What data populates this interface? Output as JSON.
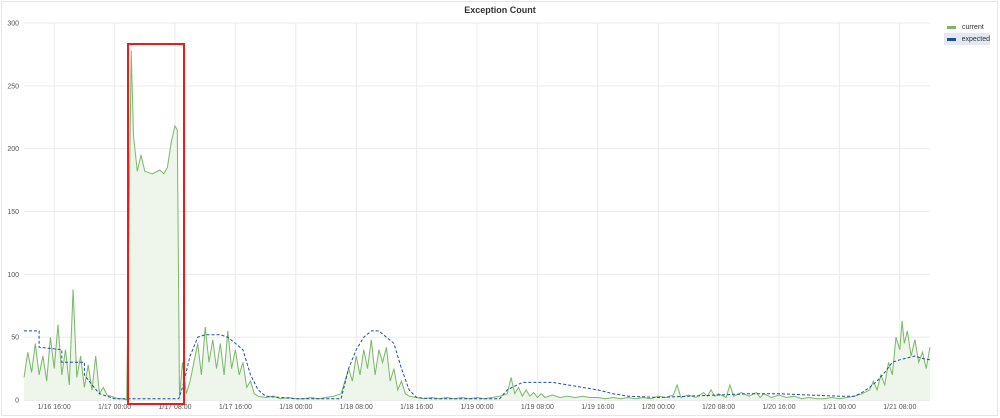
{
  "panel": {
    "title": "Exception Count"
  },
  "legend": {
    "items": [
      {
        "label": "current",
        "color": "#7ab76a"
      },
      {
        "label": "expected",
        "color": "#1f4e9c"
      }
    ]
  },
  "chart_data": {
    "type": "line",
    "title": "Exception Count",
    "xlabel": "",
    "ylabel": "",
    "ylim": [
      0,
      300
    ],
    "yticks": [
      0,
      50,
      100,
      150,
      200,
      250,
      300
    ],
    "x_unit": "hours since 1/16 12:00 (tick labels shown as dates)",
    "xlim": [
      0,
      120
    ],
    "xticks": [
      {
        "x": 4,
        "label": "1/16 16:00"
      },
      {
        "x": 12,
        "label": "1/17 00:00"
      },
      {
        "x": 20,
        "label": "1/17 08:00"
      },
      {
        "x": 28,
        "label": "1/17 16:00"
      },
      {
        "x": 36,
        "label": "1/18 00:00"
      },
      {
        "x": 44,
        "label": "1/18 08:00"
      },
      {
        "x": 52,
        "label": "1/18 16:00"
      },
      {
        "x": 60,
        "label": "1/19 00:00"
      },
      {
        "x": 68,
        "label": "1/19 08:00"
      },
      {
        "x": 76,
        "label": "1/19 16:00"
      },
      {
        "x": 84,
        "label": "1/20 00:00"
      },
      {
        "x": 92,
        "label": "1/20 08:00"
      },
      {
        "x": 100,
        "label": "1/20 16:00"
      },
      {
        "x": 108,
        "label": "1/21 00:00"
      },
      {
        "x": 116,
        "label": "1/21 08:00"
      }
    ],
    "grid": true,
    "legend_position": "top-right",
    "series": [
      {
        "name": "current",
        "color": "#7ab76a",
        "fill": "#eef5ea",
        "points": [
          [
            0,
            18
          ],
          [
            0.5,
            38
          ],
          [
            1,
            22
          ],
          [
            1.5,
            45
          ],
          [
            2,
            20
          ],
          [
            2.5,
            35
          ],
          [
            3,
            15
          ],
          [
            3.5,
            50
          ],
          [
            4,
            25
          ],
          [
            4.5,
            60
          ],
          [
            5,
            20
          ],
          [
            5.5,
            40
          ],
          [
            6,
            12
          ],
          [
            6.5,
            88
          ],
          [
            7,
            18
          ],
          [
            7.5,
            35
          ],
          [
            8,
            10
          ],
          [
            8.5,
            28
          ],
          [
            9,
            8
          ],
          [
            9.5,
            35
          ],
          [
            10,
            5
          ],
          [
            10.5,
            10
          ],
          [
            11,
            4
          ],
          [
            11.5,
            3
          ],
          [
            12,
            2
          ],
          [
            12.5,
            1
          ],
          [
            13,
            1
          ],
          [
            13.6,
            0
          ],
          [
            14.2,
            278
          ],
          [
            14.5,
            210
          ],
          [
            15,
            182
          ],
          [
            15.5,
            195
          ],
          [
            16,
            182
          ],
          [
            17,
            180
          ],
          [
            18,
            183
          ],
          [
            18.5,
            180
          ],
          [
            19,
            185
          ],
          [
            19.5,
            205
          ],
          [
            20,
            218
          ],
          [
            20.3,
            215
          ],
          [
            20.6,
            2
          ],
          [
            21,
            30
          ],
          [
            21.5,
            5
          ],
          [
            22,
            15
          ],
          [
            22.5,
            30
          ],
          [
            23,
            45
          ],
          [
            23.5,
            20
          ],
          [
            24,
            58
          ],
          [
            24.5,
            30
          ],
          [
            25,
            48
          ],
          [
            25.5,
            25
          ],
          [
            26,
            45
          ],
          [
            26.5,
            20
          ],
          [
            27,
            55
          ],
          [
            27.5,
            25
          ],
          [
            28,
            40
          ],
          [
            28.5,
            20
          ],
          [
            29,
            30
          ],
          [
            29.5,
            10
          ],
          [
            30,
            15
          ],
          [
            30.5,
            5
          ],
          [
            31,
            3
          ],
          [
            32,
            2
          ],
          [
            33,
            3
          ],
          [
            34,
            1
          ],
          [
            35,
            2
          ],
          [
            36,
            1
          ],
          [
            37,
            1
          ],
          [
            38,
            2
          ],
          [
            39,
            1
          ],
          [
            40,
            2
          ],
          [
            41,
            3
          ],
          [
            42,
            5
          ],
          [
            42.5,
            15
          ],
          [
            43,
            25
          ],
          [
            43.5,
            15
          ],
          [
            44,
            35
          ],
          [
            44.5,
            20
          ],
          [
            45,
            40
          ],
          [
            45.5,
            25
          ],
          [
            46,
            48
          ],
          [
            46.5,
            20
          ],
          [
            47,
            40
          ],
          [
            47.5,
            30
          ],
          [
            48,
            42
          ],
          [
            48.5,
            15
          ],
          [
            49,
            25
          ],
          [
            49.5,
            8
          ],
          [
            50,
            15
          ],
          [
            50.5,
            5
          ],
          [
            51,
            3
          ],
          [
            52,
            2
          ],
          [
            53,
            1
          ],
          [
            54,
            2
          ],
          [
            55,
            1
          ],
          [
            56,
            2
          ],
          [
            57,
            1
          ],
          [
            58,
            2
          ],
          [
            59,
            1
          ],
          [
            60,
            2
          ],
          [
            61,
            1
          ],
          [
            62,
            2
          ],
          [
            63,
            3
          ],
          [
            64,
            5
          ],
          [
            64.5,
            18
          ],
          [
            65,
            5
          ],
          [
            65.5,
            10
          ],
          [
            66,
            3
          ],
          [
            66.5,
            8
          ],
          [
            67,
            3
          ],
          [
            67.5,
            6
          ],
          [
            68,
            2
          ],
          [
            68.5,
            5
          ],
          [
            69,
            2
          ],
          [
            70,
            4
          ],
          [
            71,
            2
          ],
          [
            72,
            3
          ],
          [
            73,
            2
          ],
          [
            74,
            3
          ],
          [
            75,
            2
          ],
          [
            76,
            2
          ],
          [
            77,
            1
          ],
          [
            78,
            2
          ],
          [
            79,
            1
          ],
          [
            80,
            2
          ],
          [
            81,
            1
          ],
          [
            82,
            2
          ],
          [
            83,
            1
          ],
          [
            84,
            3
          ],
          [
            85,
            2
          ],
          [
            86,
            4
          ],
          [
            86.5,
            12
          ],
          [
            87,
            2
          ],
          [
            88,
            4
          ],
          [
            89,
            2
          ],
          [
            90,
            6
          ],
          [
            90.5,
            3
          ],
          [
            91,
            8
          ],
          [
            91.5,
            3
          ],
          [
            92,
            5
          ],
          [
            93,
            2
          ],
          [
            93.5,
            12
          ],
          [
            94,
            3
          ],
          [
            95,
            6
          ],
          [
            96,
            3
          ],
          [
            97,
            6
          ],
          [
            97.5,
            2
          ],
          [
            98,
            5
          ],
          [
            99,
            2
          ],
          [
            100,
            4
          ],
          [
            101,
            2
          ],
          [
            102,
            3
          ],
          [
            103,
            1
          ],
          [
            104,
            2
          ],
          [
            105,
            1
          ],
          [
            106,
            1
          ],
          [
            107,
            2
          ],
          [
            108,
            1
          ],
          [
            109,
            2
          ],
          [
            110,
            3
          ],
          [
            111,
            5
          ],
          [
            112,
            8
          ],
          [
            112.5,
            15
          ],
          [
            113,
            8
          ],
          [
            113.5,
            20
          ],
          [
            114,
            12
          ],
          [
            114.5,
            30
          ],
          [
            115,
            20
          ],
          [
            115.5,
            50
          ],
          [
            116,
            40
          ],
          [
            116.3,
            63
          ],
          [
            116.6,
            45
          ],
          [
            117,
            55
          ],
          [
            117.5,
            35
          ],
          [
            118,
            48
          ],
          [
            118.5,
            30
          ],
          [
            119,
            38
          ],
          [
            119.5,
            25
          ],
          [
            120,
            42
          ]
        ]
      },
      {
        "name": "expected",
        "color": "#1f4e9c",
        "dashed": true,
        "points": [
          [
            0,
            55
          ],
          [
            2,
            55
          ],
          [
            2,
            42
          ],
          [
            5,
            40
          ],
          [
            5,
            30
          ],
          [
            8,
            30
          ],
          [
            8,
            20
          ],
          [
            9,
            12
          ],
          [
            10,
            5
          ],
          [
            11,
            3
          ],
          [
            12,
            1
          ],
          [
            20.5,
            1
          ],
          [
            21,
            10
          ],
          [
            22,
            35
          ],
          [
            23,
            50
          ],
          [
            24,
            52
          ],
          [
            26,
            52
          ],
          [
            27,
            50
          ],
          [
            28,
            45
          ],
          [
            29,
            40
          ],
          [
            30,
            20
          ],
          [
            31,
            8
          ],
          [
            32,
            3
          ],
          [
            34,
            2
          ],
          [
            36,
            1
          ],
          [
            42,
            1
          ],
          [
            43,
            25
          ],
          [
            44,
            40
          ],
          [
            45,
            50
          ],
          [
            46,
            55
          ],
          [
            47,
            55
          ],
          [
            48,
            50
          ],
          [
            49,
            45
          ],
          [
            50,
            25
          ],
          [
            51,
            8
          ],
          [
            52,
            2
          ],
          [
            54,
            1
          ],
          [
            63,
            1
          ],
          [
            64,
            8
          ],
          [
            66,
            14
          ],
          [
            70,
            14
          ],
          [
            72,
            12
          ],
          [
            74,
            10
          ],
          [
            76,
            8
          ],
          [
            78,
            5
          ],
          [
            80,
            3
          ],
          [
            84,
            2
          ],
          [
            88,
            3
          ],
          [
            92,
            4
          ],
          [
            96,
            5
          ],
          [
            100,
            5
          ],
          [
            104,
            4
          ],
          [
            108,
            3
          ],
          [
            110,
            3
          ],
          [
            111,
            6
          ],
          [
            112,
            10
          ],
          [
            113,
            15
          ],
          [
            114,
            22
          ],
          [
            115,
            30
          ],
          [
            116,
            32
          ],
          [
            118,
            35
          ],
          [
            119,
            33
          ],
          [
            120,
            32
          ]
        ]
      }
    ]
  }
}
